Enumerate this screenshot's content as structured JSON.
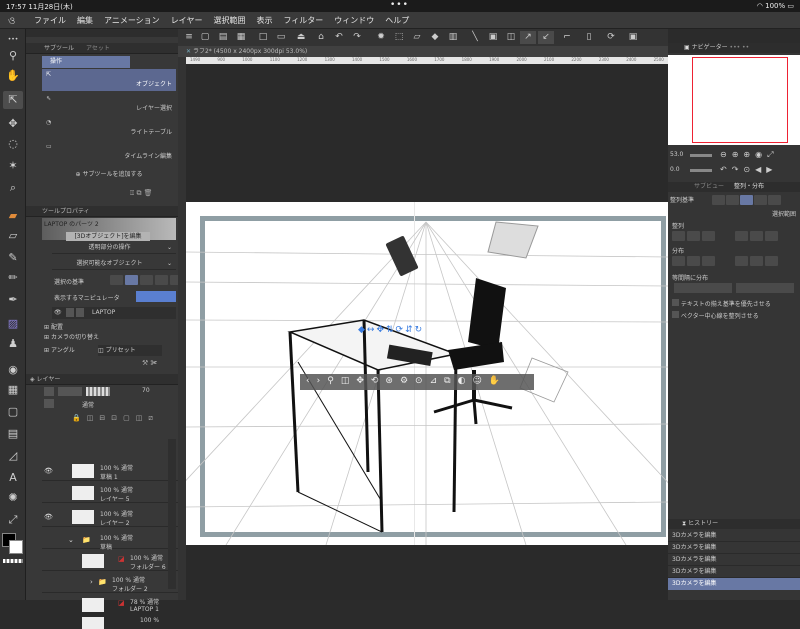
{
  "status": {
    "time": "17:57",
    "date": "11月28日(木)",
    "dots": "•••",
    "battery": "100%"
  },
  "menu": [
    "ファイル",
    "編集",
    "アニメーション",
    "レイヤー",
    "選択範囲",
    "表示",
    "フィルター",
    "ウィンドウ",
    "ヘルプ"
  ],
  "doc_tab": "ラフ2* (4500 x 2400px 300dpi 53.0%)",
  "ruler": [
    "1490",
    "900",
    "1000",
    "1100",
    "1200",
    "1300",
    "1400",
    "1500",
    "1600",
    "1700",
    "1800",
    "1900",
    "2000",
    "2100",
    "2200",
    "2300",
    "2400",
    "2500"
  ],
  "sub": {
    "tab1": "サブツール",
    "tab2": "アセット",
    "header": "操作",
    "items": [
      "オブジェクト",
      "レイヤー選択",
      "ライトテーブル",
      "タイムライン編集"
    ],
    "add": "サブツールを追加する"
  },
  "prop": {
    "tab": "ツールプロパティ",
    "object": "LAPTOP のパーツ 2",
    "mode_btn": "[3Dオブジェクト]を編集",
    "collapse1": "透明部分の操作",
    "collapse2": "選択可能なオブジェクト",
    "sel_label": "選択の基準",
    "manip": "表示するマニピュレータ",
    "laptop": "LAPTOP",
    "pose": "配置",
    "camera": "カメラの切り替え",
    "angle": "アングル",
    "preset": "プリセット"
  },
  "layers": {
    "tab": "レイヤー",
    "blend": "通常",
    "opacity": "70",
    "items": [
      {
        "pct": "100 %",
        "mode": "通常",
        "name": "草稿 1"
      },
      {
        "pct": "100 %",
        "mode": "通常",
        "name": "レイヤー 5"
      },
      {
        "pct": "100 %",
        "mode": "通常",
        "name": "レイヤー 2"
      },
      {
        "pct": "100 %",
        "mode": "通常",
        "name": "草稿"
      },
      {
        "pct": "100 %",
        "mode": "通常",
        "name": "フォルダー 6"
      },
      {
        "pct": "100 %",
        "mode": "通常",
        "name": "フォルダー 2"
      },
      {
        "pct": "78 %",
        "mode": "通常",
        "name": "LAPTOP 1"
      },
      {
        "pct": "100 %",
        "mode": "通常",
        "name": ""
      }
    ]
  },
  "nav": {
    "tab1": "ナビゲーター",
    "zoom": "53.0",
    "rot": "0.0"
  },
  "align": {
    "tab1": "サブビュー",
    "tab2": "整列・分布",
    "base_label": "整列基準",
    "base_value": "選択範囲",
    "align": "整列",
    "distribute": "分布",
    "spacing": "等間隔に分布",
    "opt1": "テキストの揃え基準を優先させる",
    "opt2": "ベクター中心線を整列させる"
  },
  "history": {
    "tab": "ヒストリー",
    "items": [
      "3Dカメラを編集",
      "3Dカメラを編集",
      "3Dカメラを編集",
      "3Dカメラを編集",
      "3Dカメラを編集"
    ]
  }
}
